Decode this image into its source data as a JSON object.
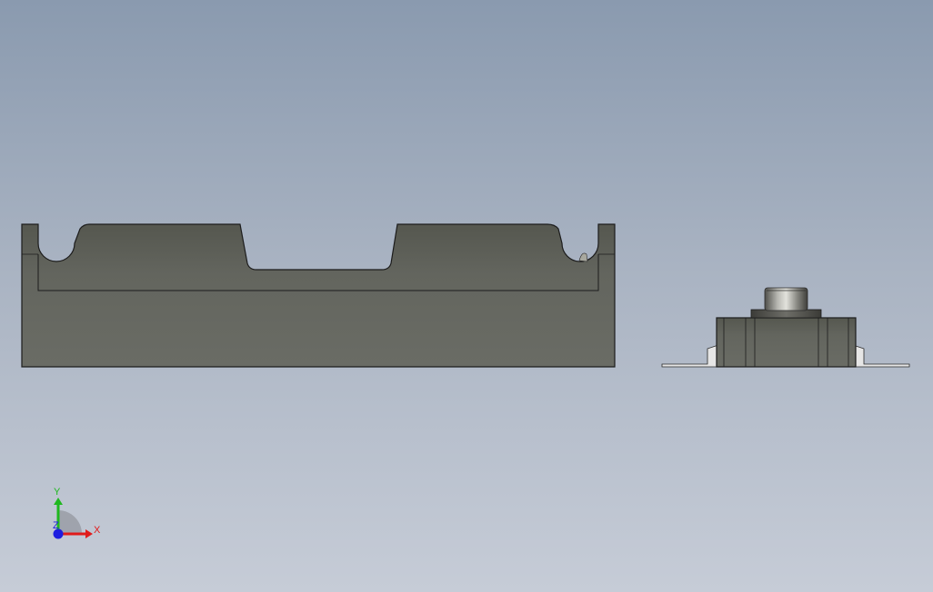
{
  "viewport": {
    "background_top": "#8a9aaf",
    "background_bottom": "#c6ccd7"
  },
  "model": {
    "body_color": "#646660",
    "body_top_color": "#585a54",
    "outline_color": "#1c1c1c",
    "pin_color": "#9a9a95",
    "bracket_color": "#e6e6e6"
  },
  "triad": {
    "x_label": "X",
    "y_label": "Y",
    "z_label": "Z",
    "x_color": "#e01b1b",
    "y_color": "#1fb81f",
    "z_color": "#1e1ee0"
  }
}
